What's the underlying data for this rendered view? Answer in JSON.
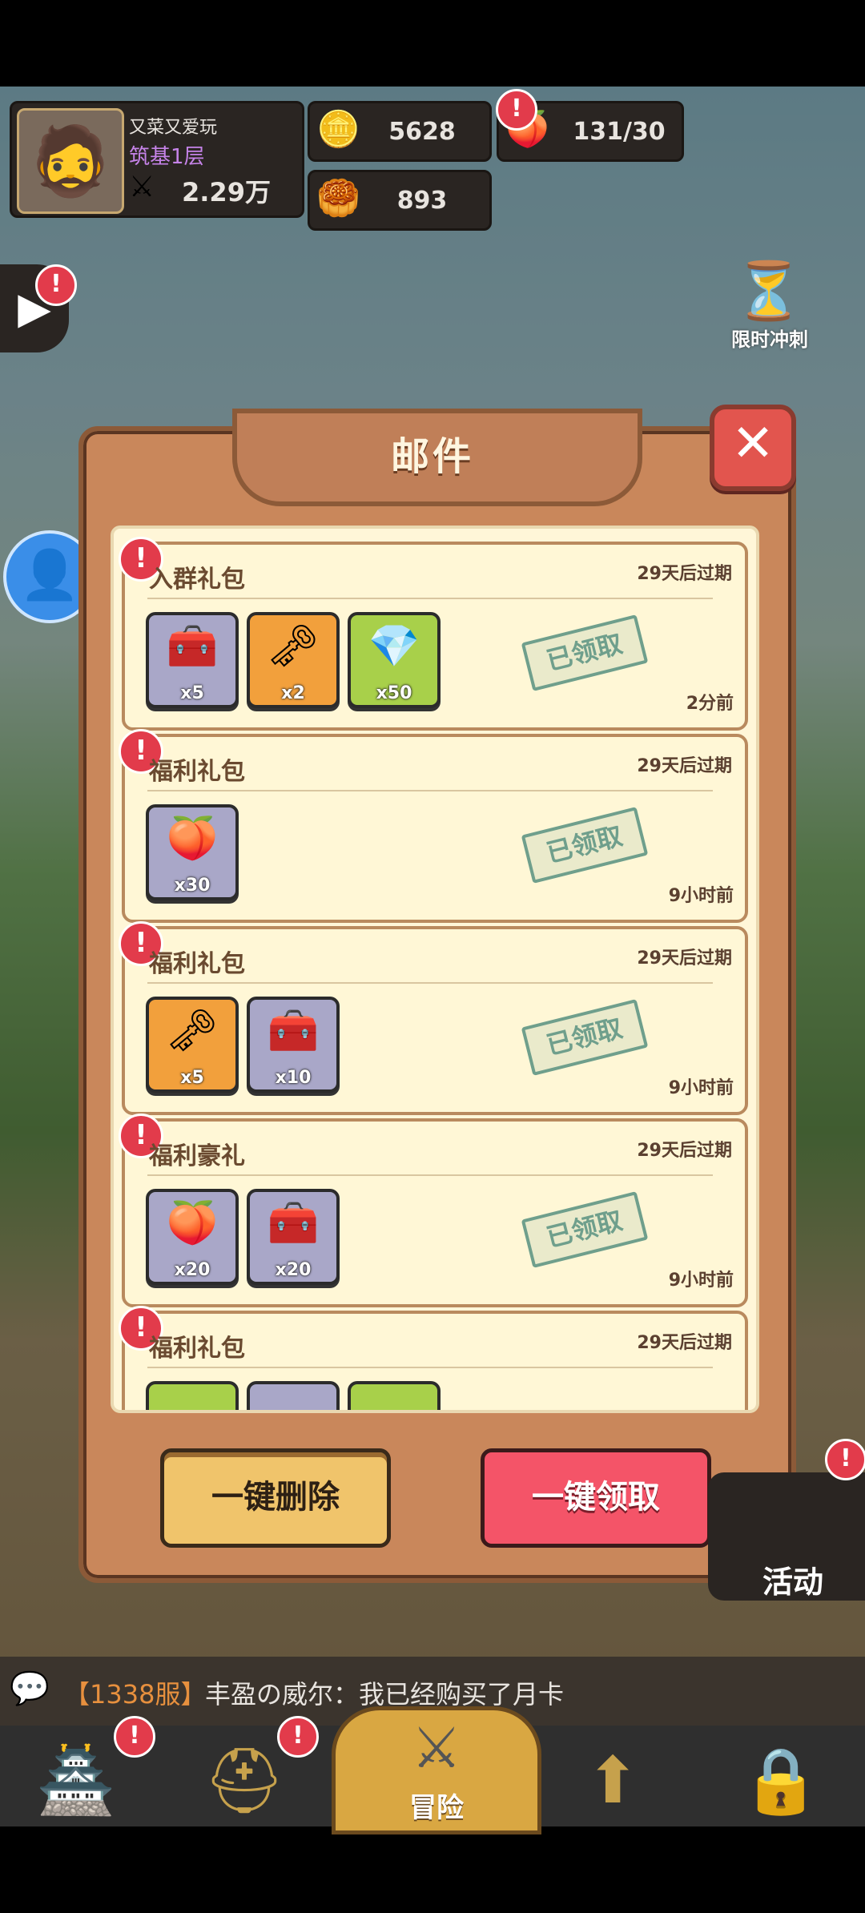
{
  "hud": {
    "player_name": "又菜又爱玩",
    "player_rank": "筑基1层",
    "power": "2.29万",
    "gold": "5628",
    "peach": "131/30",
    "coins": "893"
  },
  "side": {
    "time_limit_label": "限时冲刺",
    "activity_label": "活动",
    "alert_symbol": "!"
  },
  "modal": {
    "title": "邮件",
    "close_symbol": "✕",
    "delete_all": "一键删除",
    "claim_all": "一键领取",
    "claimed_stamp": "已领取"
  },
  "mails": [
    {
      "title": "入群礼包",
      "expire": "29天后过期",
      "time": "2分前",
      "items": [
        {
          "icon": "treasure-chest",
          "color": "gray",
          "qty": "x5"
        },
        {
          "icon": "golden-key",
          "color": "orange",
          "qty": "x2"
        },
        {
          "icon": "blue-crystal",
          "color": "green",
          "qty": "x50"
        }
      ]
    },
    {
      "title": "福利礼包",
      "expire": "29天后过期",
      "time": "9小时前",
      "items": [
        {
          "icon": "peach",
          "color": "gray",
          "qty": "x30"
        }
      ]
    },
    {
      "title": "福利礼包",
      "expire": "29天后过期",
      "time": "9小时前",
      "items": [
        {
          "icon": "golden-key",
          "color": "orange",
          "qty": "x5"
        },
        {
          "icon": "treasure-chest",
          "color": "gray",
          "qty": "x10"
        }
      ]
    },
    {
      "title": "福利豪礼",
      "expire": "29天后过期",
      "time": "9小时前",
      "items": [
        {
          "icon": "peach",
          "color": "gray",
          "qty": "x20"
        },
        {
          "icon": "treasure-chest",
          "color": "gray",
          "qty": "x20"
        }
      ]
    },
    {
      "title": "福利礼包",
      "expire": "29天后过期",
      "time": "",
      "items": []
    }
  ],
  "chat": {
    "server": "【1338服】",
    "message": "丰盈の威尔：我已经购买了月卡"
  },
  "nav": {
    "adventure_label": "冒险"
  },
  "colors": {
    "claim_red": "#f45468",
    "delete_yellow": "#f0c46b",
    "alert_red": "#e23b4b",
    "stamp_green": "#6f9f8c"
  }
}
